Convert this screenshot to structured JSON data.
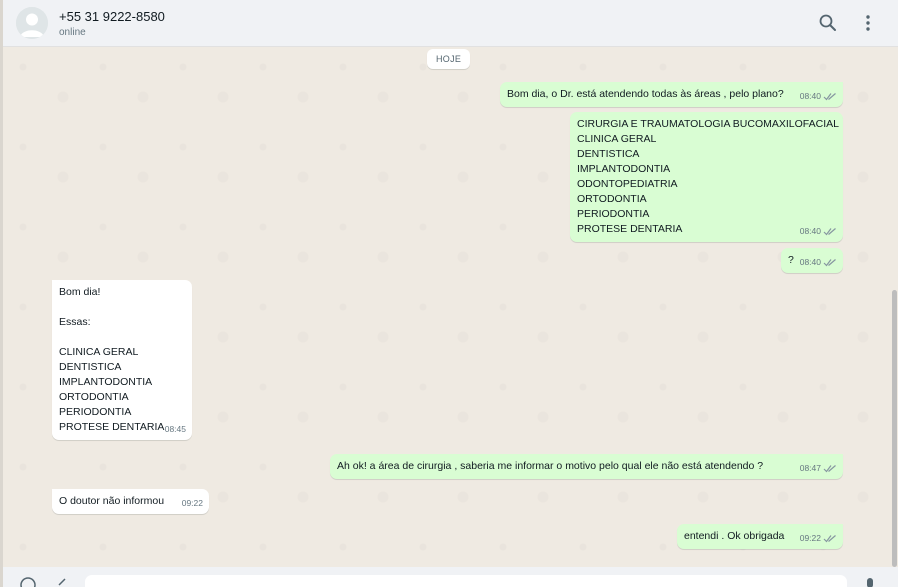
{
  "header": {
    "contact_name": "+55 31 9222-8580",
    "contact_status": "online",
    "icons": [
      "avatar",
      "search-icon",
      "menu-icon"
    ]
  },
  "chat": {
    "day_label": "HOJE",
    "messages": [
      {
        "dir": "out",
        "lines": [
          "Bom dia, o Dr. está atendendo todas às áreas , pelo plano?"
        ],
        "time": "08:40",
        "status": "read"
      },
      {
        "dir": "out",
        "lines": [
          "CIRURGIA E TRAUMATOLOGIA BUCOMAXILOFACIAL",
          "CLINICA GERAL",
          "DENTISTICA",
          "IMPLANTODONTIA",
          "ODONTOPEDIATRIA",
          "ORTODONTIA",
          "PERIODONTIA",
          "PROTESE DENTARIA"
        ],
        "time": "08:40",
        "status": "read"
      },
      {
        "dir": "out",
        "lines": [
          "?"
        ],
        "time": "08:40",
        "status": "read"
      },
      {
        "dir": "in",
        "lines": [
          "Bom dia!",
          "",
          "Essas:",
          "",
          "CLINICA GERAL",
          "DENTISTICA",
          "IMPLANTODONTIA",
          "ORTODONTIA",
          "PERIODONTIA",
          "PROTESE DENTARIA"
        ],
        "time": "08:45"
      },
      {
        "dir": "out",
        "lines": [
          "Ah ok! a área de cirurgia , saberia me informar o motivo pelo qual ele não está atendendo ?"
        ],
        "time": "08:47",
        "status": "read"
      },
      {
        "dir": "in",
        "lines": [
          "O doutor não informou"
        ],
        "time": "09:22"
      },
      {
        "dir": "out",
        "lines": [
          "entendi . Ok obrigada"
        ],
        "time": "09:22",
        "status": "read"
      }
    ]
  },
  "colors": {
    "outgoing_bubble": "#d9fdd3",
    "incoming_bubble": "#ffffff",
    "chat_background": "#efeae2",
    "header_background": "#f0f2f5",
    "read_ticks": "#8696a0"
  }
}
